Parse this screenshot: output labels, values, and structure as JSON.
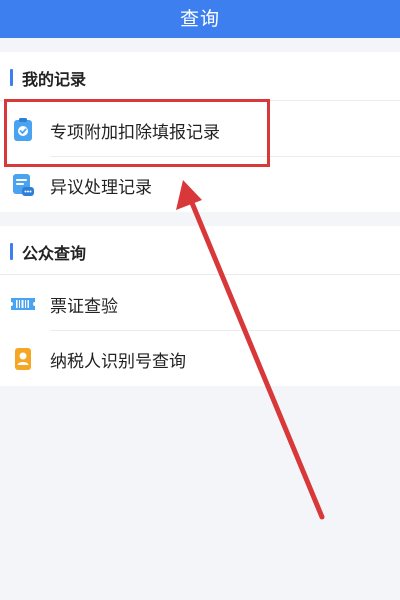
{
  "header": {
    "title": "查询"
  },
  "sections": [
    {
      "title": "我的记录",
      "items": [
        {
          "label": "专项附加扣除填报记录",
          "icon": "clipboard-check-icon"
        },
        {
          "label": "异议处理记录",
          "icon": "chat-document-icon"
        }
      ]
    },
    {
      "title": "公众查询",
      "items": [
        {
          "label": "票证查验",
          "icon": "barcode-ticket-icon"
        },
        {
          "label": "纳税人识别号查询",
          "icon": "person-id-icon"
        }
      ]
    }
  ],
  "colors": {
    "header_bg": "#3d7fef",
    "accent": "#3d7fef",
    "highlight": "#d8383a",
    "background": "#f4f5f8"
  }
}
